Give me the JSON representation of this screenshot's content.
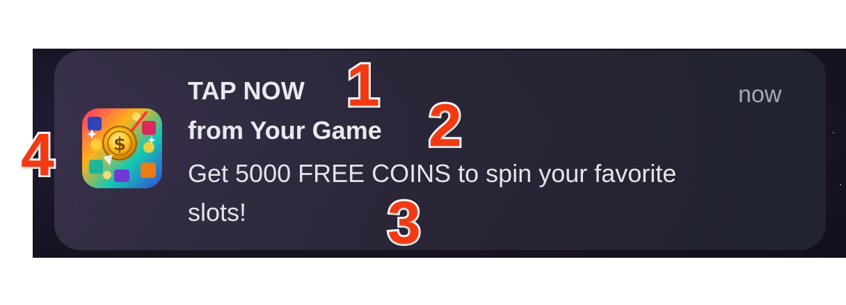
{
  "notification": {
    "title": "TAP NOW",
    "subtitle": "from Your Game",
    "body": "Get 5000 FREE COINS to spin your favorite slots!",
    "timestamp": "now",
    "app_icon": "slot-coins-app-icon"
  },
  "annotations": {
    "marker_1": "1",
    "marker_2": "2",
    "marker_3": "3",
    "marker_4": "4"
  },
  "colors": {
    "marker": "#f23a12",
    "card": "#2c283a",
    "wallpaper": "#1b1628",
    "text": "#e9e9ee",
    "timestamp": "#a9a9b2"
  }
}
